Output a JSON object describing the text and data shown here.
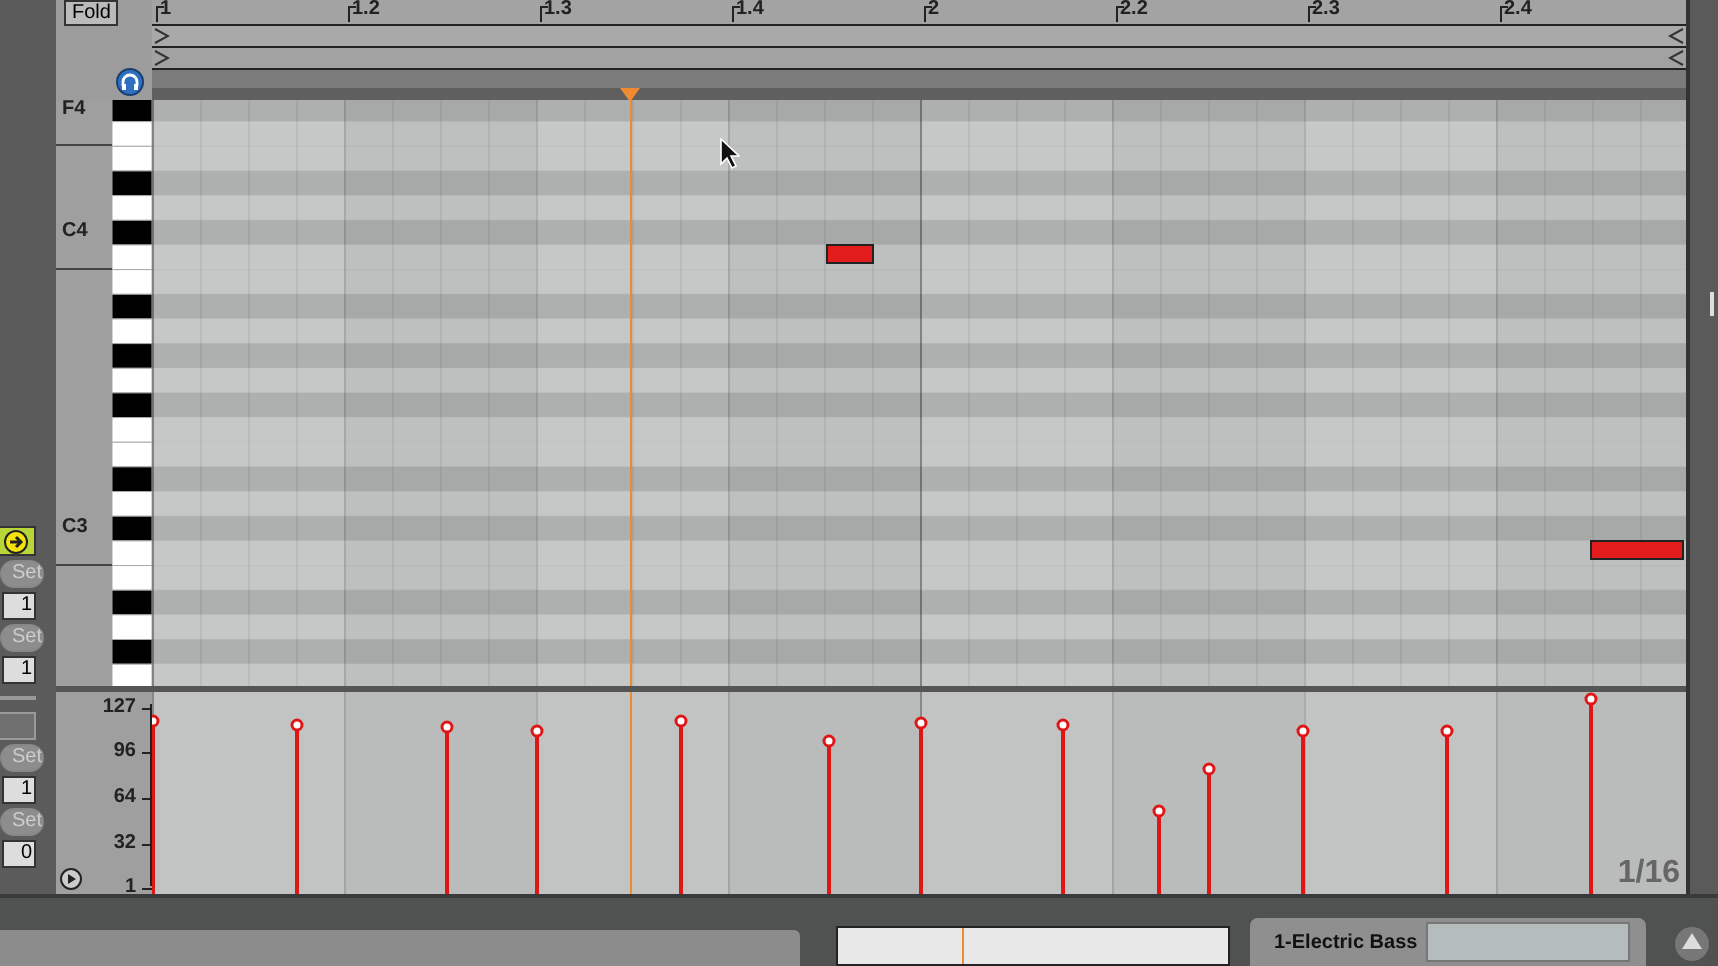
{
  "fold_button": {
    "label": "Fold"
  },
  "ruler": {
    "labels": [
      "1",
      "1.2",
      "1.3",
      "1.4",
      "2",
      "2.2",
      "2.3",
      "2.4"
    ]
  },
  "key_labels": [
    "F4",
    "C4",
    "C3"
  ],
  "side_controls": [
    {
      "kind": "toggle",
      "on": true
    },
    {
      "kind": "set",
      "label": "Set"
    },
    {
      "kind": "number",
      "value": "1"
    },
    {
      "kind": "set",
      "label": "Set"
    },
    {
      "kind": "number",
      "value": "1"
    },
    {
      "kind": "rule"
    },
    {
      "kind": "field"
    },
    {
      "kind": "set",
      "label": "Set"
    },
    {
      "kind": "number",
      "value": "1"
    },
    {
      "kind": "set",
      "label": "Set"
    },
    {
      "kind": "number",
      "value": "0"
    }
  ],
  "velocity_scale": [
    "127",
    "96",
    "64",
    "32",
    "1"
  ],
  "grid_quantize": "1/16",
  "track": {
    "name": "1-Electric Bass"
  }
}
